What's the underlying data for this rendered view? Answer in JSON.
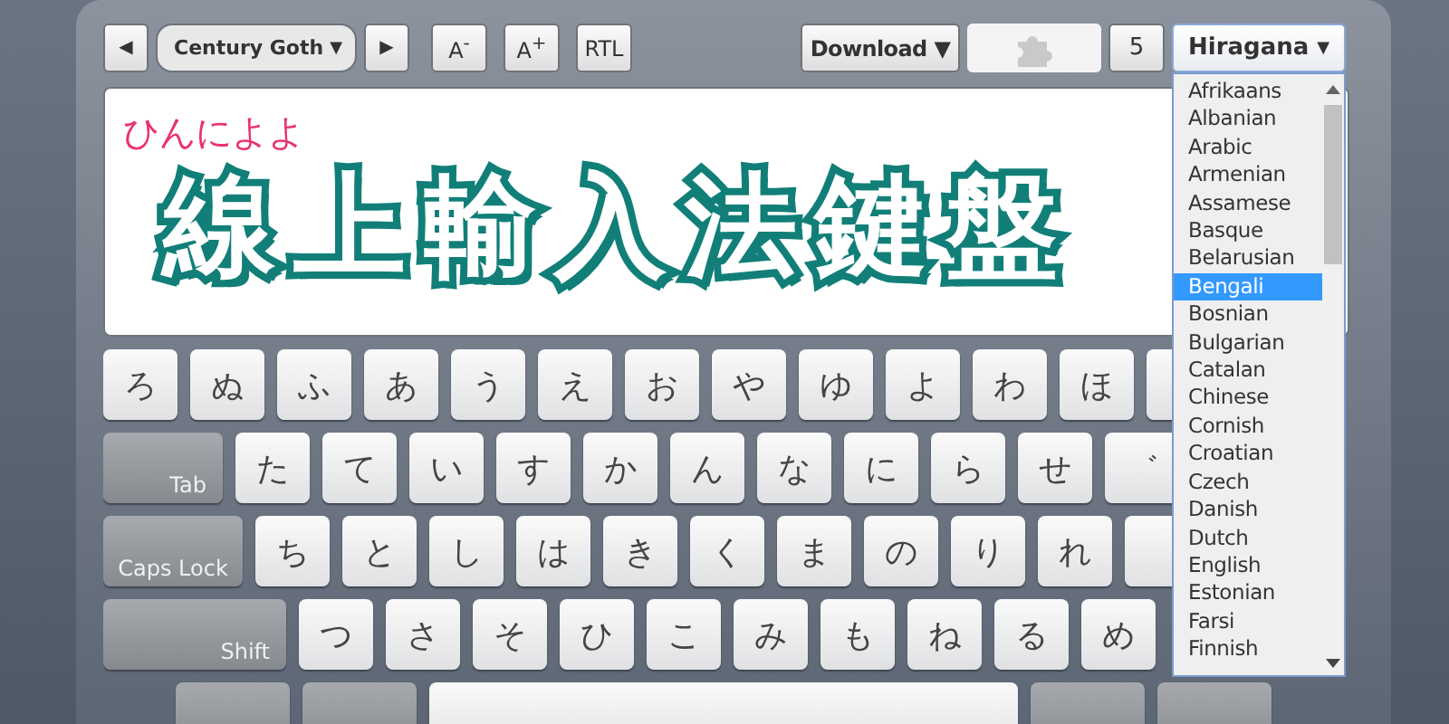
{
  "toolbar": {
    "prev_button": "◀",
    "font_select": {
      "value": "Century Goth",
      "arrow": "▼"
    },
    "next_button": "▶",
    "smaller_button": "A$^{-}$",
    "larger_button": "A$^{+}$",
    "rtl_button": "RTL",
    "download_button": "Download ▼",
    "plugin_button": {
      "disabled": true
    },
    "count_button": "5"
  },
  "layout_select": {
    "value": "Hiragana",
    "arrow": "▼",
    "expanded": true,
    "options": [
      {
        "label": "Afrikaans",
        "selected": false
      },
      {
        "label": "Albanian",
        "selected": false
      },
      {
        "label": "Arabic",
        "selected": false
      },
      {
        "label": "Armenian",
        "selected": false
      },
      {
        "label": "Assamese",
        "selected": false
      },
      {
        "label": "Basque",
        "selected": false
      },
      {
        "label": "Belarusian",
        "selected": false
      },
      {
        "label": "Bengali",
        "selected": true
      },
      {
        "label": "Bosnian",
        "selected": false
      },
      {
        "label": "Bulgarian",
        "selected": false
      },
      {
        "label": "Catalan",
        "selected": false
      },
      {
        "label": "Chinese",
        "selected": false
      },
      {
        "label": "Cornish",
        "selected": false
      },
      {
        "label": "Croatian",
        "selected": false
      },
      {
        "label": "Czech",
        "selected": false
      },
      {
        "label": "Danish",
        "selected": false
      },
      {
        "label": "Dutch",
        "selected": false
      },
      {
        "label": "English",
        "selected": false
      },
      {
        "label": "Estonian",
        "selected": false
      },
      {
        "label": "Farsi",
        "selected": false
      },
      {
        "label": "Finnish",
        "selected": false
      }
    ]
  },
  "text_area": {
    "value": "ひんによよ",
    "overlay_title": "線上輸入法鍵盤"
  },
  "keyboard": {
    "rows": [
      {
        "keys": [
          {
            "kind": "char",
            "label": "ろ"
          },
          {
            "kind": "char",
            "label": "ぬ"
          },
          {
            "kind": "char",
            "label": "ふ"
          },
          {
            "kind": "char",
            "label": "あ"
          },
          {
            "kind": "char",
            "label": "う"
          },
          {
            "kind": "char",
            "label": "え"
          },
          {
            "kind": "char",
            "label": "お"
          },
          {
            "kind": "char",
            "label": "や"
          },
          {
            "kind": "char",
            "label": "ゆ"
          },
          {
            "kind": "char",
            "label": "よ"
          },
          {
            "kind": "char",
            "label": "わ"
          },
          {
            "kind": "char",
            "label": "ほ"
          },
          {
            "kind": "char"
          }
        ]
      },
      {
        "keys": [
          {
            "kind": "tab",
            "label": "Tab"
          },
          {
            "kind": "char",
            "label": "た"
          },
          {
            "kind": "char",
            "label": "て"
          },
          {
            "kind": "char",
            "label": "い"
          },
          {
            "kind": "char",
            "label": "す"
          },
          {
            "kind": "char",
            "label": "か"
          },
          {
            "kind": "char",
            "label": "ん"
          },
          {
            "kind": "char",
            "label": "な"
          },
          {
            "kind": "char",
            "label": "に"
          },
          {
            "kind": "char",
            "label": "ら"
          },
          {
            "kind": "char",
            "label": "せ"
          },
          {
            "kind": "char",
            "label": "゛"
          }
        ]
      },
      {
        "keys": [
          {
            "kind": "caps",
            "label": "Caps Lock"
          },
          {
            "kind": "char",
            "label": "ち"
          },
          {
            "kind": "char",
            "label": "と"
          },
          {
            "kind": "char",
            "label": "し"
          },
          {
            "kind": "char",
            "label": "は"
          },
          {
            "kind": "char",
            "label": "き"
          },
          {
            "kind": "char",
            "label": "く"
          },
          {
            "kind": "char",
            "label": "ま"
          },
          {
            "kind": "char",
            "label": "の"
          },
          {
            "kind": "char",
            "label": "り"
          },
          {
            "kind": "char",
            "label": "れ"
          },
          {
            "kind": "char"
          }
        ]
      },
      {
        "keys": [
          {
            "kind": "shift",
            "label": "Shift"
          },
          {
            "kind": "char",
            "label": "つ"
          },
          {
            "kind": "char",
            "label": "さ"
          },
          {
            "kind": "char",
            "label": "そ"
          },
          {
            "kind": "char",
            "label": "ひ"
          },
          {
            "kind": "char",
            "label": "こ"
          },
          {
            "kind": "char",
            "label": "み"
          },
          {
            "kind": "char",
            "label": "も"
          },
          {
            "kind": "char",
            "label": "ね"
          },
          {
            "kind": "char",
            "label": "る"
          },
          {
            "kind": "char",
            "label": "め"
          }
        ]
      },
      {
        "keys": [
          {
            "kind": "mod"
          },
          {
            "kind": "mod"
          },
          {
            "kind": "space"
          },
          {
            "kind": "mod"
          },
          {
            "kind": "mod"
          }
        ]
      }
    ]
  }
}
